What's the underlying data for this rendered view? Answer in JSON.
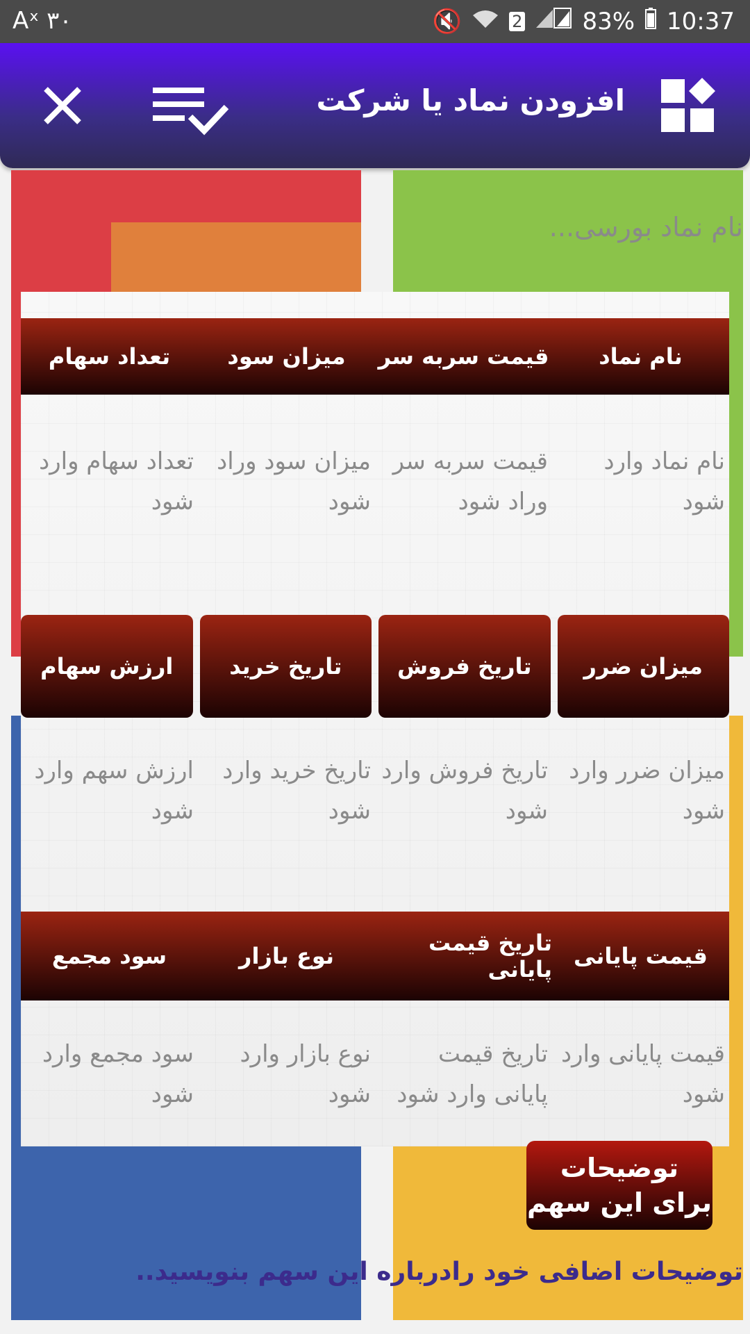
{
  "status_bar": {
    "left_text": "Aˣ ۳۰",
    "battery": "83%",
    "time": "10:37",
    "sim_badge": "2"
  },
  "app_bar": {
    "title": "افزودن نماد یا شرکت"
  },
  "symbol_input": {
    "placeholder": "نام نماد بورسی..."
  },
  "section1": {
    "headers": [
      "نام نماد",
      "قیمت سربه سر",
      "میزان سود",
      "تعداد سهام"
    ],
    "placeholders": [
      "نام نماد وارد شود",
      "قیمت سربه سر وراد شود",
      "میزان سود وراد شود",
      "تعداد سهام وارد شود"
    ]
  },
  "section2": {
    "buttons": [
      "میزان ضرر",
      "تاریخ فروش",
      "تاریخ خرید",
      "ارزش سهام"
    ],
    "placeholders": [
      "میزان ضرر وارد شود",
      "تاریخ فروش وارد شود",
      "تاریخ خرید وارد شود",
      "ارزش سهم وارد شود"
    ]
  },
  "section3": {
    "headers": [
      "قیمت پایانی",
      "تاریخ قیمت پایانی",
      "نوع بازار",
      "سود مجمع"
    ],
    "placeholders": [
      "قیمت پایانی وارد شود",
      "تاریخ قیمت پایانی وارد شود",
      "نوع بازار وارد شود",
      "سود مجمع وارد شود"
    ]
  },
  "description": {
    "button_label": "توضیحات برای این سهم",
    "placeholder": "توضیحات اضافی خود رادرباره این سهم بنویسید.."
  },
  "colors": {
    "appbar_top": "#5a10f2",
    "appbar_bottom": "#2f2a55",
    "header_red": "#9b2412",
    "tile_red": "#dc3e45",
    "tile_orange": "#e0803c",
    "tile_green": "#8bc34a",
    "tile_blue": "#3d64ac",
    "tile_yellow": "#f0b93a"
  }
}
